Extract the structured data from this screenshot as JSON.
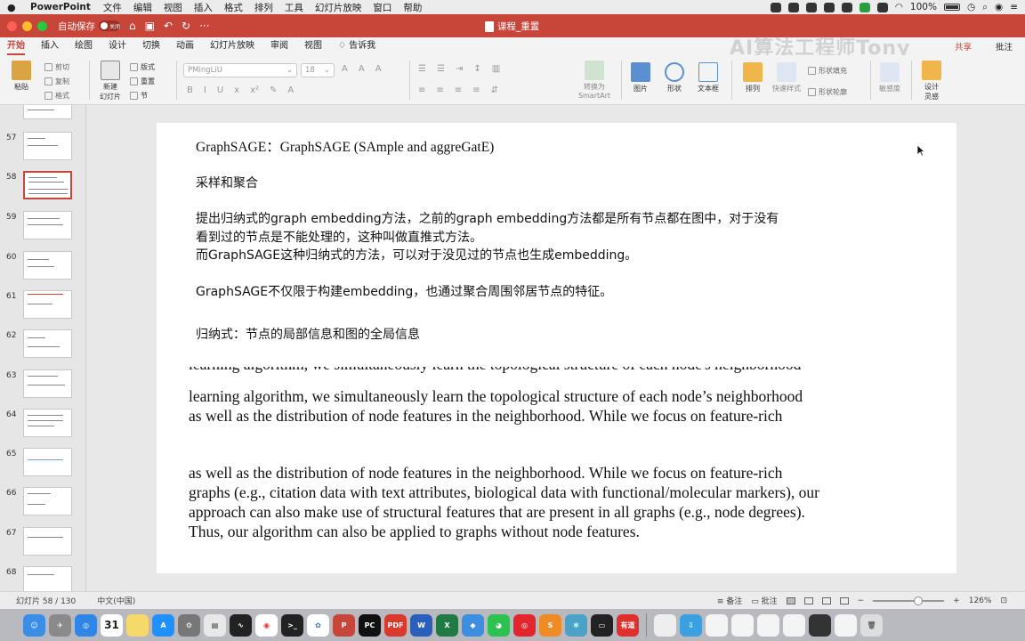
{
  "menubar": {
    "app_name": "PowerPoint",
    "items": [
      "文件",
      "编辑",
      "视图",
      "插入",
      "格式",
      "排列",
      "工具",
      "幻灯片放映",
      "窗口",
      "帮助"
    ],
    "battery": "100%"
  },
  "titlebar": {
    "autosave_label": "自动保存",
    "autosave_state": "关闭",
    "document_title": "课程_重置"
  },
  "ribbon_tabs": {
    "items": [
      "开始",
      "插入",
      "绘图",
      "设计",
      "切换",
      "动画",
      "幻灯片放映",
      "审阅",
      "视图"
    ],
    "tell_me": "告诉我",
    "watermark": "AI算法工程师Tony",
    "share": "共享",
    "comments": "批注"
  },
  "ribbon": {
    "paste": "粘贴",
    "cut": "剪切",
    "copy": "复制",
    "format": "格式",
    "new_slide_line1": "新建",
    "new_slide_line2": "幻灯片",
    "layout": "版式",
    "reset": "重置",
    "section": "节",
    "font_name": "PMingLiU",
    "font_size": "18",
    "convert_line1": "转换为",
    "convert_line2": "SmartArt",
    "picture": "图片",
    "shape": "形状",
    "textbox": "文本框",
    "arrange": "排列",
    "quick_styles": "快速样式",
    "shape_fill": "形状填充",
    "shape_outline": "形状轮廓",
    "sensitivity": "敏感度",
    "design_line1": "设计",
    "design_line2": "灵感"
  },
  "slides_panel": {
    "numbers": [
      "57",
      "58",
      "59",
      "60",
      "61",
      "62",
      "63",
      "64",
      "65",
      "66",
      "67",
      "68"
    ],
    "selected": "58"
  },
  "slide": {
    "title": "GraphSAGE：GraphSAGE (SAmple and aggreGatE)",
    "subtitle": "采样和聚合",
    "para1_line1": "提出归纳式的graph embedding方法，之前的graph embedding方法都是所有节点都在图中，对于没有",
    "para1_line2": "看到过的节点是不能处理的，这种叫做直推式方法。",
    "para1_line3": "而GraphSAGE这种归纳式的方法，可以对于没见过的节点也生成embedding。",
    "para2": "GraphSAGE不仅限于构建embedding，也通过聚合周围邻居节点的特征。",
    "para3": "归纳式：节点的局部信息和图的全局信息",
    "paper_cut": "learning algorithm, we simultaneously learn the topological structure of each node's neighborhood",
    "paper1_line1": "learning algorithm, we simultaneously learn the topological structure of each node’s neighborhood",
    "paper1_line2": "as well as the distribution of node features in the neighborhood.  While we focus on feature-rich",
    "paper2_line1": "as well as the distribution of node features in the neighborhood.  While we focus on feature-rich",
    "paper2_line2": "graphs (e.g., citation data with text attributes, biological data with functional/molecular markers), our",
    "paper2_line3": "approach can also make use of structural features that are present in all graphs (e.g., node degrees).",
    "paper2_line4": "Thus, our algorithm can also be applied to graphs without node features."
  },
  "statusbar": {
    "slide_info": "幻灯片 58 / 130",
    "language": "中文(中国)",
    "notes": "备注",
    "comments": "批注",
    "zoom": "126%"
  },
  "dock": {
    "calendar_day": "31",
    "apps": [
      "finder",
      "launchpad",
      "safari",
      "calendar",
      "notes",
      "appstore",
      "settings",
      "preview",
      "activity",
      "chrome",
      "terminal",
      "trae",
      "powerpoint",
      "pycharm",
      "pdf",
      "word",
      "excel",
      "paw",
      "wechat",
      "netease-music",
      "sublime",
      "network",
      "facetime",
      "youdao"
    ]
  }
}
